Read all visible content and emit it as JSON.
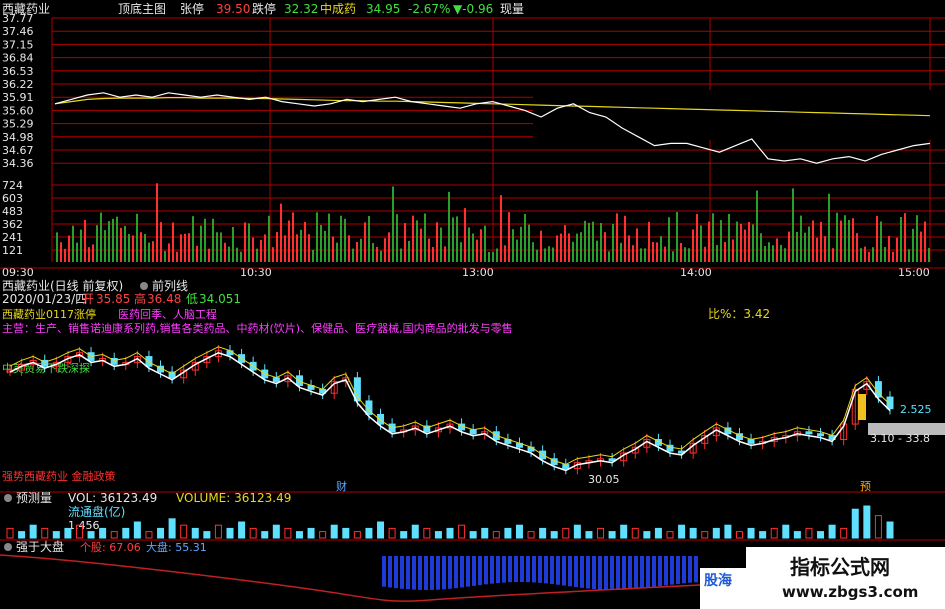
{
  "intraday_header": {
    "name": "西藏药业",
    "indicator": "顶底主图",
    "limit_up_label": "张停",
    "limit_up_value": "39.50",
    "limit_down_label": "跌停",
    "limit_down_value": "32.32",
    "sector": "中成药",
    "price": "34.95",
    "pct": "-2.67%",
    "change": "▼-0.96",
    "volume_label": "现量"
  },
  "daily_header": {
    "title": "西藏药业(日线 前复权)",
    "ma_label": "前列线",
    "date": "2020/01/23/四",
    "open_label": "开",
    "open": "35.85",
    "high_label": "高",
    "high": "36.48",
    "low_label": "低",
    "low": "34.051"
  },
  "annotations": {
    "limit_note": "西藏药业0117涨停",
    "limit_reason": "医药回季、人脑工程",
    "business": "主营：生产、销售诺迪康系列药,销售各类药品、中药材(饮片)、保健品、医疗器械,国内商品的批发与零售",
    "ratio": "比%：3.42",
    "pressure_note": "中美贸易下跌深探",
    "bottom_note": "强势西藏药业 金融政策",
    "low_price": "30.05",
    "right_price_1": "2.525",
    "right_price_2": "3.10 - 33.8",
    "marker_cai": "财",
    "marker_yu": "预"
  },
  "volume_panel": {
    "title": "预测量",
    "vol_label": "VOL: 36123.49",
    "volume_label": "VOLUME: 36123.49",
    "float_label": "流通盘(亿)",
    "float_value": "1.456"
  },
  "strength_panel": {
    "title": "强于大盘",
    "stock_label": "个股: 67.06",
    "market_label": "大盘: 55.31"
  },
  "watermark": {
    "brand": "指标公式网",
    "url": "www.zbgs3.com",
    "logo": "股海"
  },
  "colors": {
    "price_line": "#ffffff",
    "avg_line": "#e8d81a",
    "grid": "#b00000",
    "up": "#ff3030",
    "down": "#5fe0ff",
    "vol_up": "#ff3030",
    "vol_down": "#2aa02a",
    "bars_blue": "#1f3bd6"
  },
  "chart_data": [
    {
      "type": "line",
      "name": "intraday",
      "y_ticks": [
        "37.77",
        "37.46",
        "37.15",
        "36.84",
        "36.53",
        "36.22",
        "35.91",
        "35.60",
        "35.29",
        "34.98",
        "34.67",
        "34.36"
      ],
      "x_ticks": [
        "09:30",
        "10:30",
        "13:00",
        "14:00",
        "15:00"
      ],
      "ylim": [
        34.2,
        37.8
      ],
      "price": [
        35.85,
        35.95,
        36.05,
        36.1,
        36.0,
        36.05,
        36.0,
        36.1,
        36.05,
        36.0,
        36.05,
        36.0,
        35.95,
        36.0,
        35.9,
        35.85,
        35.8,
        35.85,
        35.95,
        35.9,
        35.95,
        36.0,
        35.9,
        35.85,
        35.8,
        35.75,
        35.85,
        35.9,
        35.8,
        35.7,
        35.55,
        35.75,
        35.85,
        35.65,
        35.55,
        35.3,
        35.1,
        34.9,
        34.95,
        34.95,
        34.85,
        34.75,
        34.9,
        35.05,
        34.6,
        34.55,
        34.6,
        34.5,
        34.6,
        34.65,
        34.55,
        34.7,
        34.8,
        34.9,
        34.95
      ],
      "avg": [
        35.85,
        35.9,
        35.95,
        35.97,
        35.98,
        35.98,
        35.98,
        35.99,
        35.99,
        35.98,
        35.98,
        35.98,
        35.97,
        35.97,
        35.96,
        35.95,
        35.94,
        35.93,
        35.92,
        35.92,
        35.91,
        35.91,
        35.9,
        35.89,
        35.88,
        35.87,
        35.86,
        35.85,
        35.84,
        35.83,
        35.82,
        35.81,
        35.8,
        35.79,
        35.78,
        35.77,
        35.76,
        35.75,
        35.74,
        35.73,
        35.72,
        35.71,
        35.7,
        35.69,
        35.68,
        35.67,
        35.66,
        35.65,
        35.64,
        35.63,
        35.62,
        35.61,
        35.6,
        35.59,
        35.58
      ],
      "volume_ticks": [
        "724",
        "603",
        "483",
        "362",
        "241",
        "121"
      ],
      "volume_ylim": [
        0,
        724
      ]
    },
    {
      "type": "line",
      "name": "daily-candles",
      "low_value": 30.05,
      "close": [
        35.2,
        35.5,
        35.7,
        35.4,
        35.6,
        35.9,
        36.1,
        35.7,
        35.8,
        35.5,
        35.6,
        35.9,
        35.4,
        35.1,
        34.8,
        35.2,
        35.6,
        35.9,
        36.2,
        36.0,
        35.6,
        35.2,
        34.8,
        34.6,
        34.9,
        34.4,
        34.2,
        34.0,
        34.6,
        34.8,
        33.6,
        32.9,
        32.4,
        32.0,
        32.1,
        32.3,
        32.0,
        32.2,
        32.4,
        32.1,
        31.9,
        32.0,
        31.6,
        31.4,
        31.2,
        31.0,
        30.6,
        30.3,
        30.1,
        30.4,
        30.5,
        30.6,
        30.5,
        30.9,
        31.2,
        31.6,
        31.3,
        31.0,
        30.9,
        31.4,
        31.8,
        32.2,
        31.9,
        31.6,
        31.4,
        31.5,
        31.7,
        31.8,
        32.0,
        31.9,
        31.8,
        31.6,
        32.4,
        34.2,
        34.6,
        33.8,
        33.2
      ]
    },
    {
      "type": "bar",
      "name": "daily-volume",
      "values": [
        3,
        2,
        4,
        3,
        2,
        3,
        4,
        2,
        3,
        2,
        3,
        5,
        2,
        3,
        6,
        4,
        3,
        2,
        4,
        3,
        5,
        3,
        2,
        4,
        3,
        2,
        3,
        2,
        4,
        3,
        2,
        3,
        5,
        3,
        2,
        4,
        3,
        2,
        3,
        4,
        2,
        3,
        2,
        3,
        4,
        2,
        3,
        2,
        3,
        4,
        2,
        3,
        2,
        4,
        3,
        2,
        3,
        2,
        4,
        3,
        2,
        3,
        4,
        2,
        3,
        2,
        3,
        4,
        2,
        3,
        2,
        4,
        3,
        9,
        10,
        7,
        5
      ]
    }
  ]
}
